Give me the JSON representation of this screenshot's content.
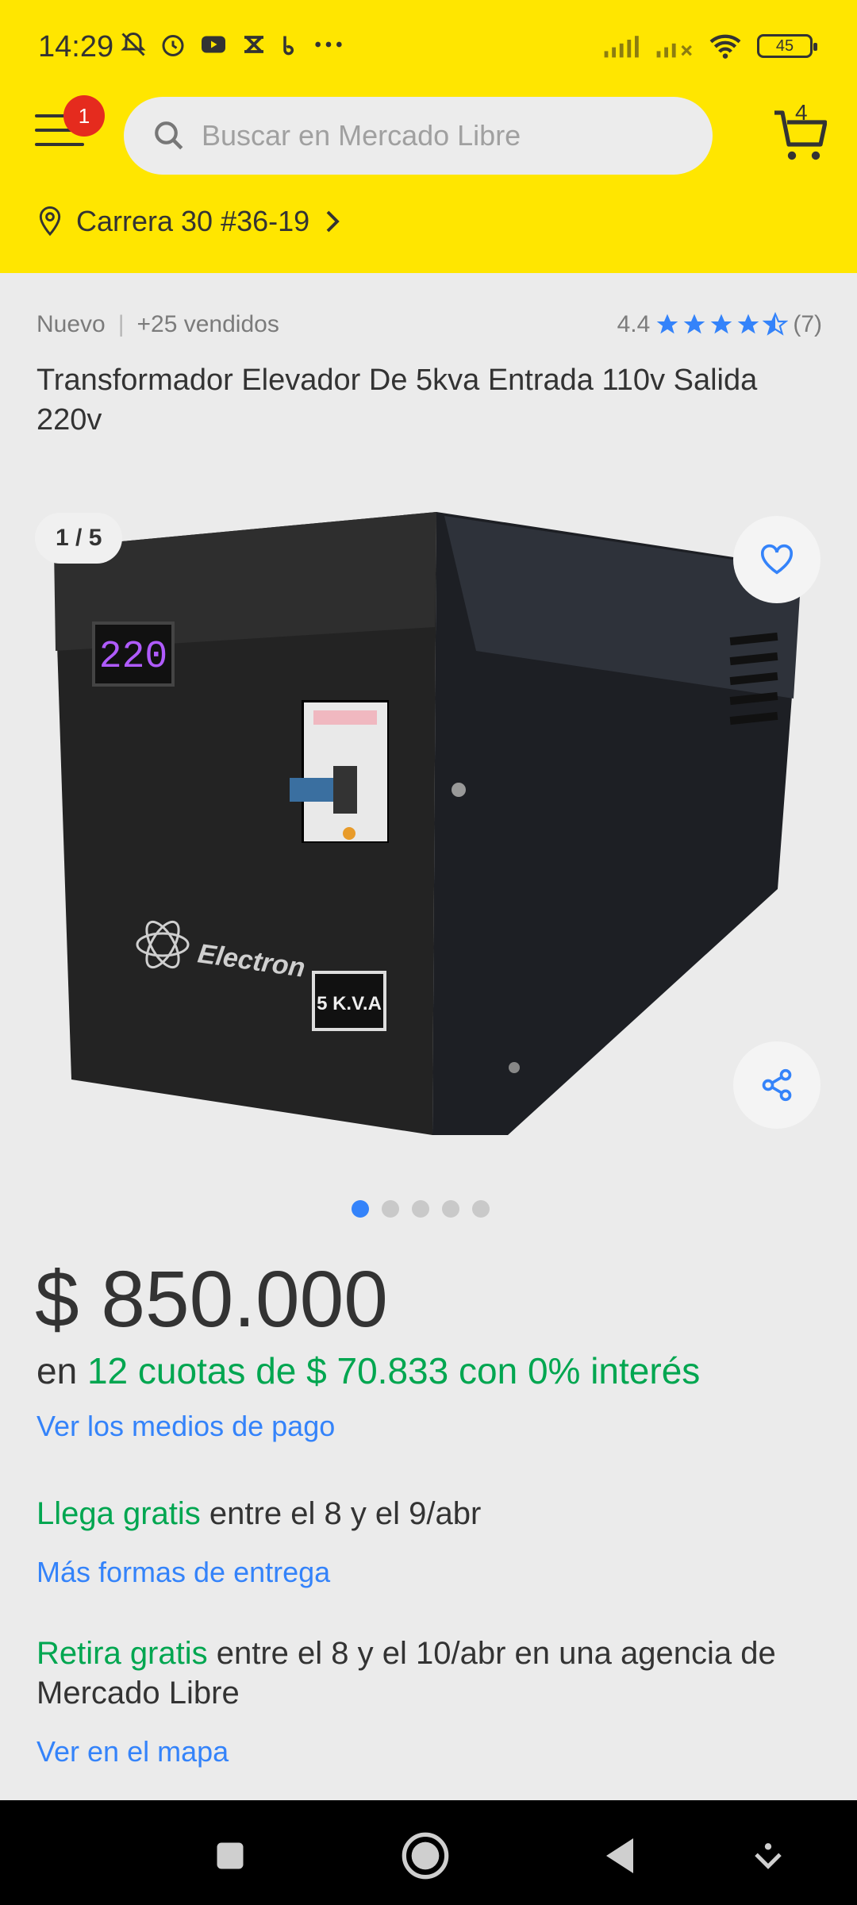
{
  "status_bar": {
    "time": "14:29",
    "battery": "45"
  },
  "header": {
    "menu_badge": "1",
    "search_placeholder": "Buscar en Mercado Libre",
    "cart_count": "4",
    "location": "Carrera 30 #36-19"
  },
  "product": {
    "condition": "Nuevo",
    "sold": "+25 vendidos",
    "rating": "4.4",
    "rating_count": "(7)",
    "rating_value": 4.4,
    "title": "Transformador Elevador De 5kva Entrada 110v Salida 220v",
    "image_counter": "1 / 5",
    "image_display_text": "220",
    "image_label": "5 K.V.A",
    "image_brand": "Electron",
    "image_dots_total": 5,
    "image_dots_active": 1,
    "price": "$ 850.000",
    "installments_prefix": "en",
    "installments_text": "12 cuotas de $ 70.833 con 0% interés",
    "payment_link": "Ver los medios de pago"
  },
  "shipping": {
    "free_label": "Llega gratis",
    "free_text": "entre el 8 y el 9/abr",
    "more_link": "Más formas de entrega",
    "pickup_label": "Retira gratis",
    "pickup_text": "entre el 8 y el 10/abr en una agencia de Mercado Libre",
    "map_link": "Ver en el mapa"
  },
  "colors": {
    "header_bg": "#ffe600",
    "link": "#3483fa",
    "green": "#00a650",
    "badge": "#e52b1e",
    "star": "#3483fa"
  }
}
